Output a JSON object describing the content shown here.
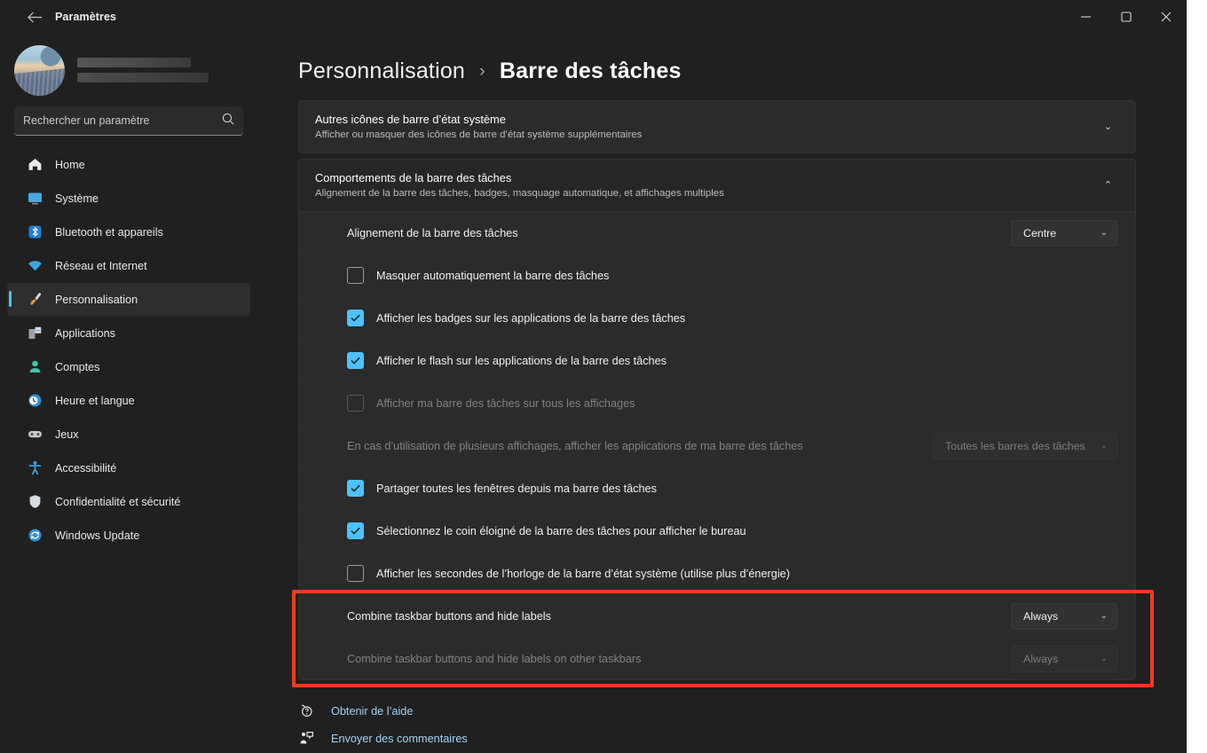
{
  "window": {
    "app_title": "Paramètres",
    "back_icon": "arrow-left-icon",
    "minimize_label": "—",
    "maximize_label": "❐",
    "close_label": "✕"
  },
  "sidebar": {
    "account": {
      "avatar_icon": "user-avatar",
      "name_redacted": true
    },
    "search": {
      "placeholder": "Rechercher un paramètre",
      "value": "",
      "icon": "search-icon"
    },
    "items": [
      {
        "label": "Home",
        "icon": "home-icon",
        "active": false
      },
      {
        "label": "Système",
        "icon": "monitor-icon",
        "active": false
      },
      {
        "label": "Bluetooth et appareils",
        "icon": "bluetooth-icon",
        "active": false
      },
      {
        "label": "Réseau et Internet",
        "icon": "wifi-icon",
        "active": false
      },
      {
        "label": "Personnalisation",
        "icon": "paintbrush-icon",
        "active": true
      },
      {
        "label": "Applications",
        "icon": "apps-icon",
        "active": false
      },
      {
        "label": "Comptes",
        "icon": "account-icon",
        "active": false
      },
      {
        "label": "Heure et langue",
        "icon": "clock-icon",
        "active": false
      },
      {
        "label": "Jeux",
        "icon": "gamepad-icon",
        "active": false
      },
      {
        "label": "Accessibilité",
        "icon": "accessibility-icon",
        "active": false
      },
      {
        "label": "Confidentialité et sécurité",
        "icon": "shield-icon",
        "active": false
      },
      {
        "label": "Windows Update",
        "icon": "update-icon",
        "active": false
      }
    ]
  },
  "breadcrumb": {
    "parent": "Personnalisation",
    "separator": "›",
    "current": "Barre des tâches"
  },
  "cards": {
    "system_icons": {
      "title": "Autres icônes de barre d’état système",
      "subtitle": "Afficher ou masquer des icônes de barre d’état système supplémentaires",
      "chevron": "⌄",
      "expanded": false
    },
    "behaviors": {
      "title": "Comportements de la barre des tâches",
      "subtitle": "Alignement de la barre des tâches, badges, masquage automatique, et affichages multiples",
      "chevron": "⌃",
      "expanded": true
    }
  },
  "rows": {
    "alignment": {
      "label": "Alignement de la barre des tâches",
      "value": "Centre",
      "chevron": "⌄",
      "disabled": false
    },
    "autohide": {
      "label": "Masquer automatiquement la barre des tâches",
      "checked": false,
      "disabled": false
    },
    "badges": {
      "label": "Afficher les badges sur les applications de la barre des tâches",
      "checked": true,
      "disabled": false
    },
    "flash": {
      "label": "Afficher le flash sur les applications de la barre des tâches",
      "checked": true,
      "disabled": false
    },
    "all_displays": {
      "label": "Afficher ma barre des tâches sur tous les affichages",
      "checked": false,
      "disabled": true
    },
    "multi_display_apps": {
      "label": "En cas d’utilisation de plusieurs affichages, afficher les applications de ma barre des tâches",
      "value": "Toutes les barres des tâches",
      "chevron": "⌄",
      "disabled": true
    },
    "share_windows": {
      "label": "Partager toutes les fenêtres depuis ma barre des tâches",
      "checked": true,
      "disabled": false
    },
    "show_desktop": {
      "label": "Sélectionnez le coin éloigné de la barre des tâches pour afficher le bureau",
      "checked": true,
      "disabled": false
    },
    "clock_seconds": {
      "label": "Afficher les secondes de l’horloge de la barre d’état système (utilise plus d’énergie)",
      "checked": false,
      "disabled": false
    },
    "combine": {
      "label": "Combine taskbar buttons and hide labels",
      "value": "Always",
      "chevron": "⌄",
      "disabled": false
    },
    "combine_other": {
      "label": "Combine taskbar buttons and hide labels on other taskbars",
      "value": "Always",
      "chevron": "⌄",
      "disabled": true
    }
  },
  "highlight": {
    "color": "#f23b1e"
  },
  "footer": {
    "help": {
      "label": "Obtenir de l’aide",
      "icon": "help-question-icon"
    },
    "feedback": {
      "label": "Envoyer des commentaires",
      "icon": "feedback-icon"
    }
  },
  "colors": {
    "accent": "#4cc2ff",
    "link": "#9fd2f5",
    "highlight": "#f23b1e"
  }
}
